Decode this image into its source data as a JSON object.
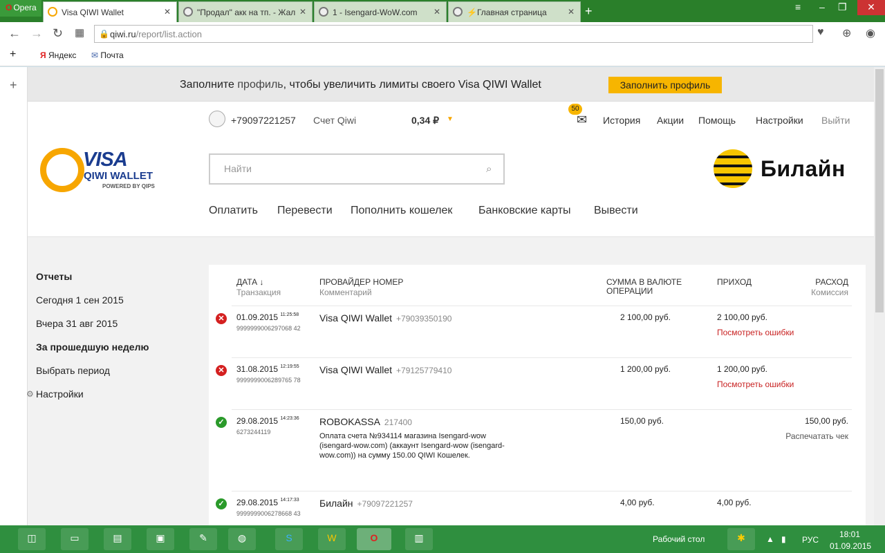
{
  "browser": {
    "menu_label": "Opera",
    "tabs": [
      {
        "label": "Visa QIWI Wallet",
        "active": true
      },
      {
        "label": "\"Продал\" акк на тп. - Жал"
      },
      {
        "label": "1 - Isengard-WoW.com"
      },
      {
        "label": "⚡Главная страница"
      }
    ],
    "address": {
      "domain": "qiwi.ru",
      "path": "/report/list.action"
    },
    "bookmarks": [
      "Яндекс",
      "Почта"
    ]
  },
  "banner": {
    "text_before": "Заполните ",
    "link": "профиль",
    "text_after": ", чтобы увеличить лимиты своего Visa QIWI Wallet",
    "button": "Заполнить профиль"
  },
  "header": {
    "phone": "+79097221257",
    "account_label": "Счет Qiwi",
    "balance": "0,34 ₽",
    "messages_count": "50",
    "links": [
      "История",
      "Акции",
      "Помощь",
      "Настройки",
      "Выйти"
    ],
    "search_placeholder": "Найти",
    "menu": [
      "Оплатить",
      "Перевести",
      "Пополнить кошелек",
      "Банковские карты",
      "Вывести"
    ],
    "logo": {
      "visa": "VISA",
      "wallet": "QIWI WALLET",
      "powered": "POWERED BY QIPS"
    },
    "partner": "Билайн"
  },
  "sidebar": {
    "title": "Отчеты",
    "items": [
      "Сегодня 1 сен 2015",
      "Вчера 31 авг 2015",
      "За прошедшую неделю",
      "Выбрать период",
      "Настройки"
    ]
  },
  "table": {
    "columns": {
      "date": "Дата ↓",
      "date_sub": "Транзакция",
      "provider": "Провайдер номер",
      "provider_sub": "Комментарий",
      "sum": "Сумма в валюте операции",
      "income": "Приход",
      "expense": "Расход",
      "expense_sub": "Комиссия"
    },
    "rows": [
      {
        "status": "error",
        "date": "01.09.2015",
        "time": "11:25:58",
        "txn": "9999999006297068 42",
        "provider": "Visa QIWI Wallet",
        "number": "+79039350190",
        "sum": "2 100,00 руб.",
        "income": "2 100,00 руб.",
        "error_link": "Посмотреть ошибки"
      },
      {
        "status": "error",
        "date": "31.08.2015",
        "time": "12:19:55",
        "txn": "9999999006289765 78",
        "provider": "Visa QIWI Wallet",
        "number": "+79125779410",
        "sum": "1 200,00 руб.",
        "income": "1 200,00 руб.",
        "error_link": "Посмотреть ошибки"
      },
      {
        "status": "ok",
        "date": "29.08.2015",
        "time": "14:23:36",
        "txn": "6273244119",
        "provider": "ROBOKASSA",
        "number": "217400",
        "comment": "Оплата счета №934114 магазина Isengard-wow (isengard-wow.com) (аккаунт Isengard-wow (isengard-wow.com)) на сумму 150.00 QIWI Кошелек.",
        "sum": "150,00 руб.",
        "expense": "150,00 руб.",
        "print_link": "Распечатать чек"
      },
      {
        "status": "ok",
        "date": "29.08.2015",
        "time": "14:17:33",
        "txn": "9999999006278668 43",
        "provider": "Билайн",
        "number": "+79097221257",
        "sum": "4,00 руб.",
        "income": "4,00 руб."
      }
    ]
  },
  "taskbar": {
    "desktop_label": "Рабочий стол",
    "lang": "РУС",
    "time": "18:01",
    "date": "01.09.2015"
  }
}
